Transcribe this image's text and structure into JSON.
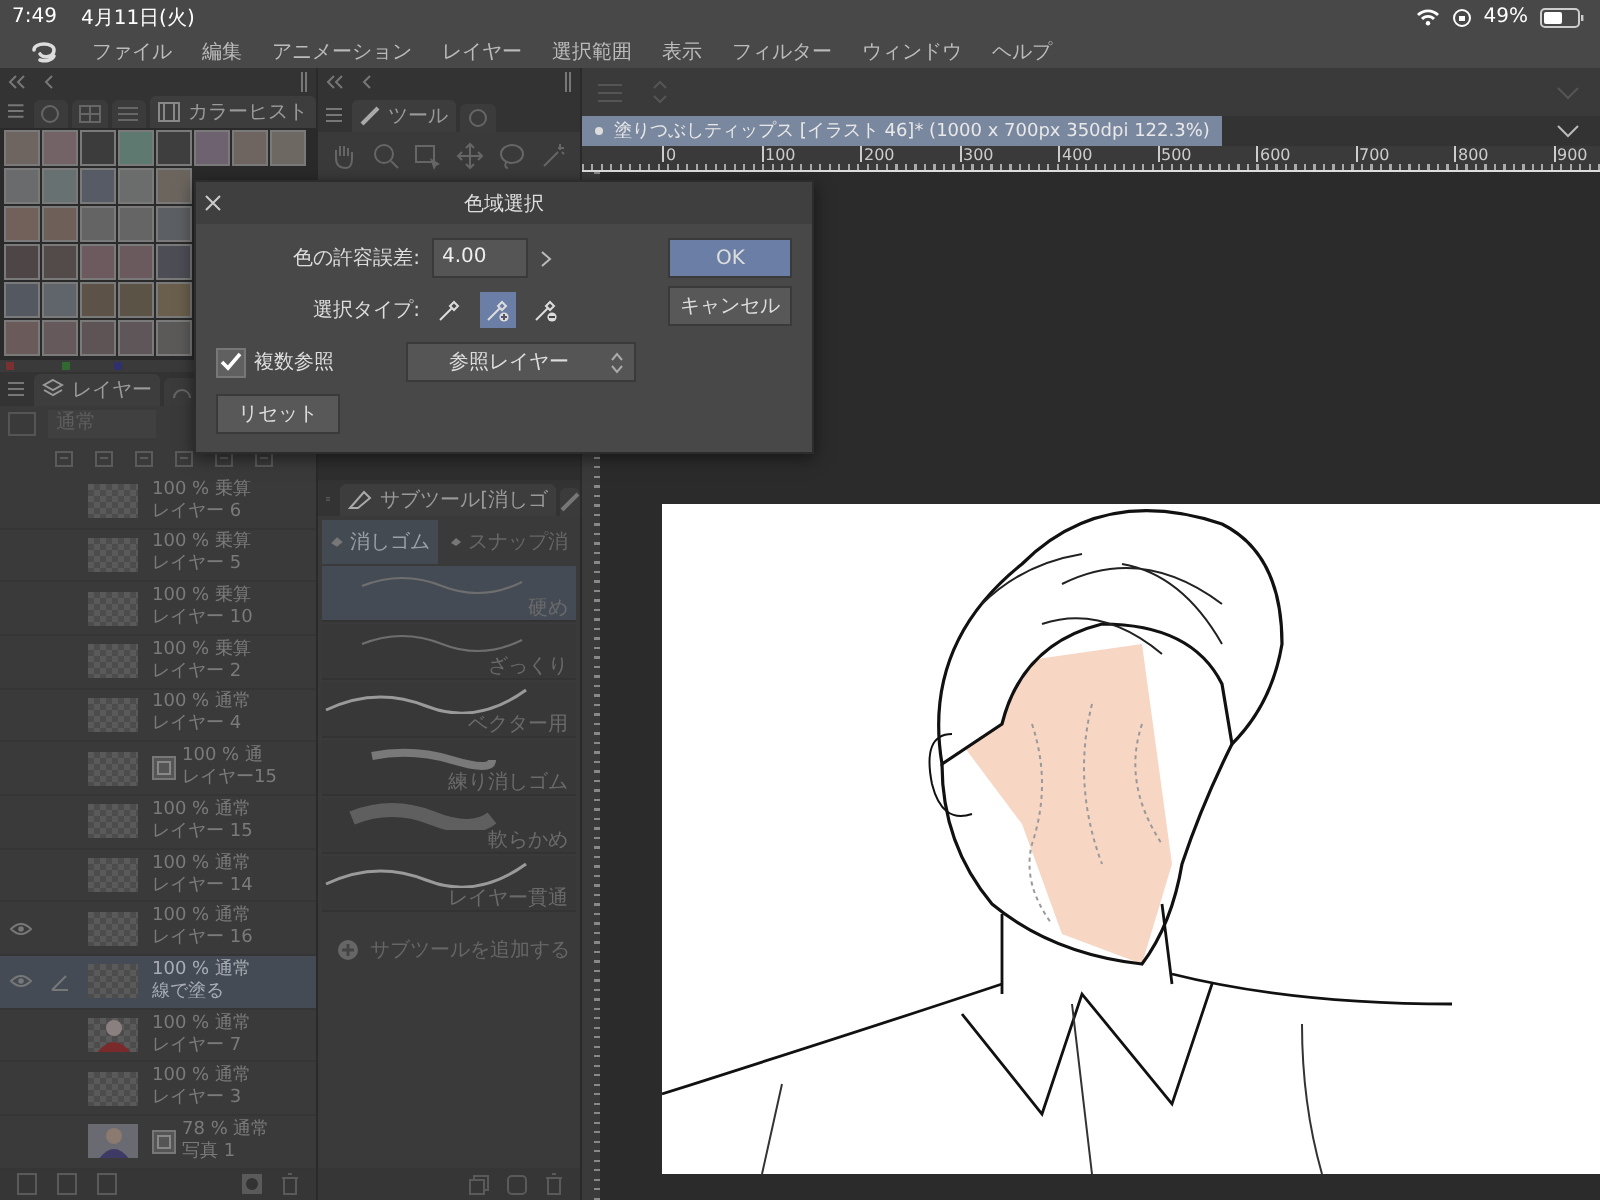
{
  "status_bar": {
    "time": "7:49",
    "date": "4月11日(火)",
    "battery": "49%"
  },
  "menu": [
    "ファイル",
    "編集",
    "アニメーション",
    "レイヤー",
    "選択範囲",
    "表示",
    "フィルター",
    "ウィンドウ",
    "ヘルプ"
  ],
  "color_panel": {
    "tab": "カラーヒスト",
    "swatches": [
      [
        {
          "color": "#6f6560"
        },
        {
          "color": "#736266"
        },
        {
          "color": "#3c3c3c"
        },
        {
          "color": "#5e7a70"
        },
        {
          "color": "#3e3e3e"
        },
        {
          "color": "#6e6170"
        },
        {
          "color": "#6e6560"
        },
        {
          "color": "#6e6863"
        }
      ],
      [
        {
          "color": "#6a6b6c"
        },
        {
          "color": "#677171"
        },
        {
          "color": "#565b66"
        },
        {
          "color": "#6b6d6c"
        },
        {
          "color": "#6b655e"
        }
      ],
      [
        {
          "color": "#72605a"
        },
        {
          "color": "#6e5f58"
        },
        {
          "color": "#646464"
        },
        {
          "color": "#656565"
        },
        {
          "color": "#5c5f63"
        }
      ],
      [
        {
          "color": "#4e4646"
        },
        {
          "color": "#534a4a"
        },
        {
          "color": "#6c5a5e"
        },
        {
          "color": "#6a5a5e"
        },
        {
          "color": "#4d4e55"
        }
      ],
      [
        {
          "color": "#535861"
        },
        {
          "color": "#5f656b"
        },
        {
          "color": "#5d5247"
        },
        {
          "color": "#5c5347"
        },
        {
          "color": "#6a5e4c"
        }
      ],
      [
        {
          "color": "#6a5a5a"
        },
        {
          "color": "#66595b"
        },
        {
          "color": "#5e5456"
        },
        {
          "color": "#5e5658"
        },
        {
          "color": "#5c5a58"
        }
      ]
    ]
  },
  "tool_panel": {
    "tab": "ツール"
  },
  "layer_panel": {
    "tab": "レイヤー",
    "blend_mode": "通常",
    "layers": [
      {
        "opacity": "100 %",
        "mode": "乗算",
        "name": "レイヤー 6",
        "visible": false,
        "selected": false,
        "kind": "blank"
      },
      {
        "opacity": "100 %",
        "mode": "乗算",
        "name": "レイヤー 5",
        "visible": false,
        "selected": false,
        "kind": "blank"
      },
      {
        "opacity": "100 %",
        "mode": "乗算",
        "name": "レイヤー 10",
        "visible": false,
        "selected": false,
        "kind": "blank"
      },
      {
        "opacity": "100 %",
        "mode": "乗算",
        "name": "レイヤー 2",
        "visible": false,
        "selected": false,
        "kind": "blank"
      },
      {
        "opacity": "100 %",
        "mode": "通常",
        "name": "レイヤー 4",
        "visible": false,
        "selected": false,
        "kind": "blank"
      },
      {
        "opacity": "100 %",
        "mode": "通",
        "name": "レイヤー15",
        "visible": false,
        "selected": false,
        "kind": "linked"
      },
      {
        "opacity": "100 %",
        "mode": "通常",
        "name": "レイヤー 15",
        "visible": false,
        "selected": false,
        "kind": "blank"
      },
      {
        "opacity": "100 %",
        "mode": "通常",
        "name": "レイヤー 14",
        "visible": false,
        "selected": false,
        "kind": "blank"
      },
      {
        "opacity": "100 %",
        "mode": "通常",
        "name": "レイヤー 16",
        "visible": true,
        "selected": false,
        "kind": "blank"
      },
      {
        "opacity": "100 %",
        "mode": "通常",
        "name": "線で塗る",
        "visible": true,
        "selected": true,
        "kind": "blank"
      },
      {
        "opacity": "100 %",
        "mode": "通常",
        "name": "レイヤー 7",
        "visible": false,
        "selected": false,
        "kind": "figure"
      },
      {
        "opacity": "100 %",
        "mode": "通常",
        "name": "レイヤー 3",
        "visible": false,
        "selected": false,
        "kind": "blank"
      },
      {
        "opacity": "78 %",
        "mode": "通常",
        "name": "写真 1",
        "visible": false,
        "selected": false,
        "kind": "photo"
      }
    ]
  },
  "subtool_panel": {
    "title": "サブツール[消しゴ",
    "tabs": [
      {
        "label": "消しゴム",
        "selected": true
      },
      {
        "label": "スナップ消",
        "selected": false
      }
    ],
    "items": [
      {
        "label": "硬め",
        "selected": true,
        "kind": "thin"
      },
      {
        "label": "ざっくり",
        "selected": false,
        "kind": "thin"
      },
      {
        "label": "ベクター用",
        "selected": false,
        "kind": "line"
      },
      {
        "label": "練り消しゴム",
        "selected": false,
        "kind": "soft"
      },
      {
        "label": "軟らかめ",
        "selected": false,
        "kind": "blur"
      },
      {
        "label": "レイヤー貫通",
        "selected": false,
        "kind": "line"
      }
    ],
    "add": "サブツールを追加する"
  },
  "document": {
    "tab": "塗りつぶしティップス [イラスト 46]* (1000 x 700px 350dpi 122.3%)",
    "ruler": [
      "0",
      "100",
      "200",
      "300",
      "400",
      "500",
      "600",
      "700",
      "800",
      "900"
    ]
  },
  "dialog": {
    "title": "色域選択",
    "tolerance_label": "色の許容誤差:",
    "tolerance": "4.00",
    "type_label": "選択タイプ:",
    "types": [
      {
        "kind": "pick",
        "selected": false
      },
      {
        "kind": "add",
        "selected": true
      },
      {
        "kind": "remove",
        "selected": false
      }
    ],
    "multi": {
      "label": "複数参照",
      "checked": true
    },
    "reference": "参照レイヤー",
    "reset": "リセット",
    "ok": "OK",
    "cancel": "キャンセル"
  }
}
